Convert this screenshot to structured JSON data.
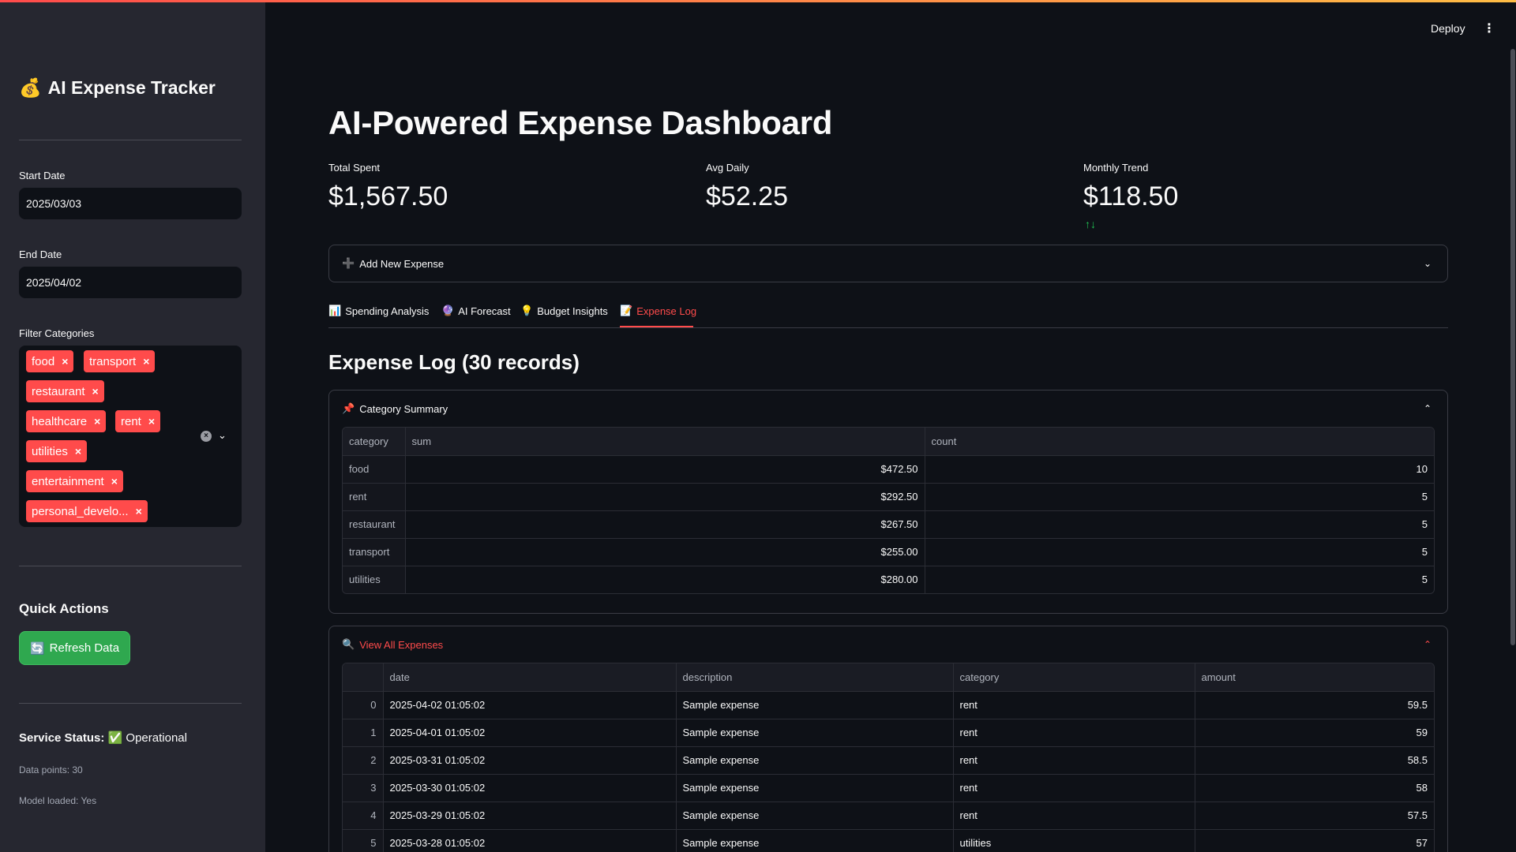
{
  "sidebar": {
    "title_icon": "💰",
    "title": "AI Expense Tracker",
    "start_date_label": "Start Date",
    "start_date": "2025/03/03",
    "end_date_label": "End Date",
    "end_date": "2025/04/02",
    "filter_label": "Filter Categories",
    "tags": [
      "food",
      "transport",
      "restaurant",
      "healthcare",
      "rent",
      "utilities",
      "entertainment",
      "personal_develo..."
    ],
    "quick_actions_title": "Quick Actions",
    "refresh_icon": "🔄",
    "refresh_label": "Refresh Data",
    "status_label": "Service Status:",
    "status_icon": "✅",
    "status_value": "Operational",
    "data_points": "Data points: 30",
    "model_loaded": "Model loaded: Yes"
  },
  "header": {
    "deploy": "Deploy",
    "menu_icon": "⋮"
  },
  "main": {
    "title": "AI-Powered Expense Dashboard",
    "metrics": [
      {
        "label": "Total Spent",
        "value": "$1,567.50"
      },
      {
        "label": "Avg Daily",
        "value": "$52.25"
      },
      {
        "label": "Monthly Trend",
        "value": "$118.50"
      }
    ],
    "trend_arrows": "↑↓",
    "add_expense_icon": "➕",
    "add_expense": "Add New Expense",
    "tabs": [
      {
        "icon": "📊",
        "label": "Spending Analysis"
      },
      {
        "icon": "🔮",
        "label": "AI Forecast"
      },
      {
        "icon": "💡",
        "label": "Budget Insights"
      },
      {
        "icon": "📝",
        "label": "Expense Log"
      }
    ],
    "section_title": "Expense Log (30 records)",
    "summary": {
      "icon": "📌",
      "title": "Category Summary",
      "columns": [
        "category",
        "sum",
        "count"
      ],
      "rows": [
        [
          "food",
          "$472.50",
          "10"
        ],
        [
          "rent",
          "$292.50",
          "5"
        ],
        [
          "restaurant",
          "$267.50",
          "5"
        ],
        [
          "transport",
          "$255.00",
          "5"
        ],
        [
          "utilities",
          "$280.00",
          "5"
        ]
      ]
    },
    "expenses": {
      "icon": "🔍",
      "title": "View All Expenses",
      "columns": [
        "",
        "date",
        "description",
        "category",
        "amount"
      ],
      "rows": [
        [
          "0",
          "2025-04-02 01:05:02",
          "Sample expense",
          "rent",
          "59.5"
        ],
        [
          "1",
          "2025-04-01 01:05:02",
          "Sample expense",
          "rent",
          "59"
        ],
        [
          "2",
          "2025-03-31 01:05:02",
          "Sample expense",
          "rent",
          "58.5"
        ],
        [
          "3",
          "2025-03-30 01:05:02",
          "Sample expense",
          "rent",
          "58"
        ],
        [
          "4",
          "2025-03-29 01:05:02",
          "Sample expense",
          "rent",
          "57.5"
        ],
        [
          "5",
          "2025-03-28 01:05:02",
          "Sample expense",
          "utilities",
          "57"
        ]
      ]
    }
  }
}
